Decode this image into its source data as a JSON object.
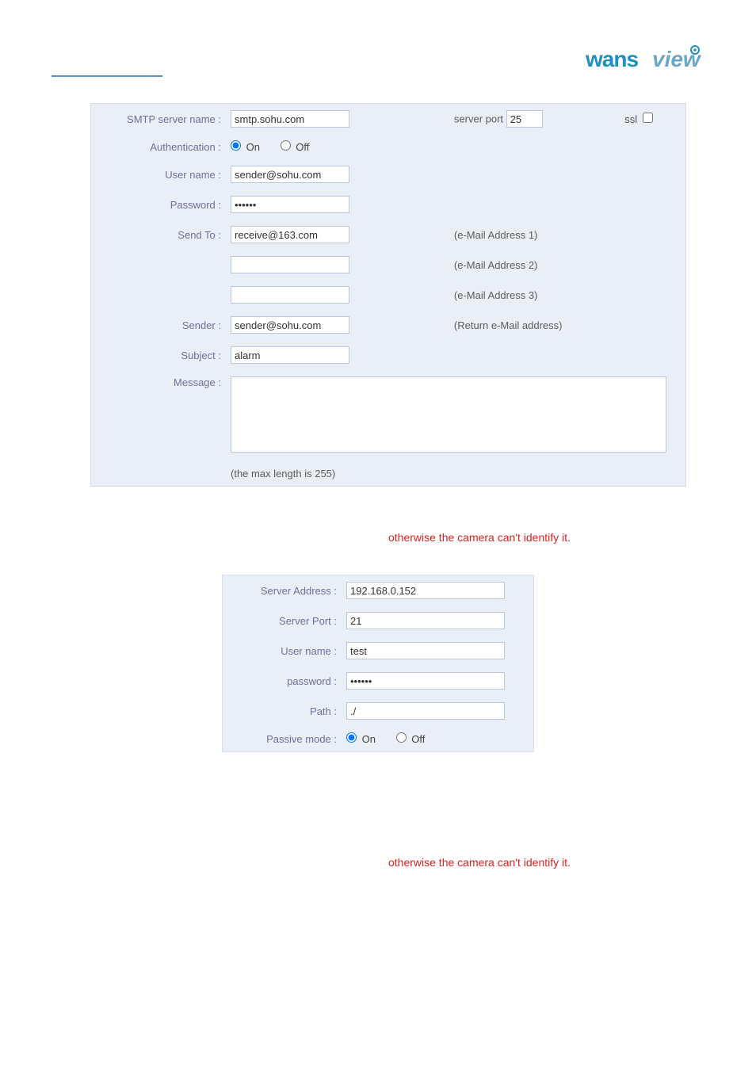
{
  "brand": "wansview",
  "email_form": {
    "smtp_label": "SMTP server name :",
    "smtp_value": "smtp.sohu.com",
    "server_port_label": "server port",
    "server_port_value": "25",
    "ssl_label": "ssl",
    "auth_label": "Authentication :",
    "on_label": "On",
    "off_label": "Off",
    "user_label": "User name :",
    "user_value": "sender@sohu.com",
    "pass_label": "Password :",
    "pass_value": "••••••",
    "sendto_label": "Send To :",
    "sendto1_value": "receive@163.com",
    "sendto2_value": "",
    "sendto3_value": "",
    "addr1": "(e-Mail Address 1)",
    "addr2": "(e-Mail Address 2)",
    "addr3": "(e-Mail Address 3)",
    "sender_label": "Sender :",
    "sender_value": "sender@sohu.com",
    "return_addr": "(Return e-Mail address)",
    "subject_label": "Subject :",
    "subject_value": "alarm",
    "message_label": "Message :",
    "maxlen": "(the max length is 255)"
  },
  "ftp_form": {
    "server_addr_label": "Server Address :",
    "server_addr_value": "192.168.0.152",
    "server_port_label": "Server Port :",
    "server_port_value": "21",
    "user_label": "User name :",
    "user_value": "test",
    "pass_label": "password :",
    "pass_value": "••••••",
    "path_label": "Path :",
    "path_value": "./",
    "passive_label": "Passive mode :",
    "on_label": "On",
    "off_label": "Off"
  },
  "warnings": {
    "line1": "otherwise the camera can't identify it.",
    "line2": "otherwise the camera can't identify it."
  }
}
